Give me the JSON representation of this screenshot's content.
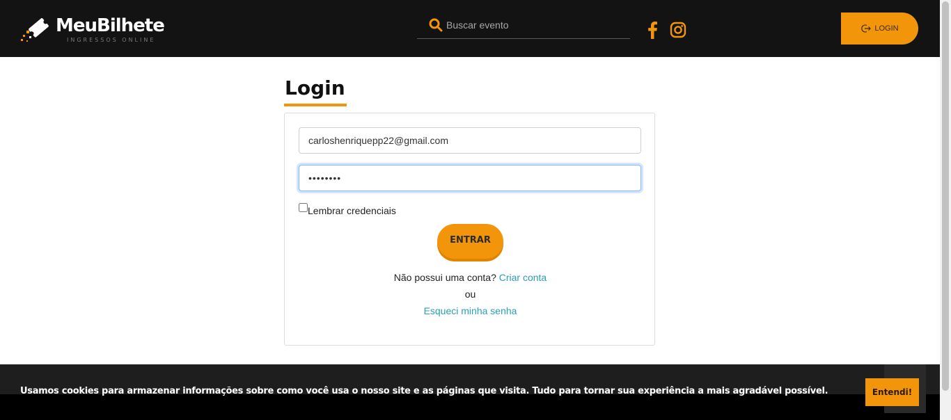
{
  "header": {
    "logo_text": "MeuBilhete",
    "logo_subtitle": "INGRESSOS ONLINE",
    "search_placeholder": "Buscar evento",
    "login_label": "LOGIN",
    "accent_color": "#f2950b"
  },
  "main": {
    "title": "Login",
    "email_value": "carloshenriquepp22@gmail.com",
    "password_value": "abcdefgh",
    "remember_label": "Lembrar credenciais",
    "submit_label": "ENTRAR",
    "no_account_text": "Não possui uma conta?",
    "create_account_link": "Criar conta",
    "or_text": "ou",
    "forgot_password_link": "Esqueci minha senha"
  },
  "cookie_banner": {
    "text": "Usamos cookies para armazenar informações sobre como você usa o nosso site e as páginas que visita. Tudo para tornar sua experiência a mais agradável possível.",
    "button_label": "Entendi!"
  },
  "icons": [
    "logo-ticket-icon",
    "search-icon",
    "facebook-icon",
    "instagram-icon",
    "login-icon"
  ]
}
